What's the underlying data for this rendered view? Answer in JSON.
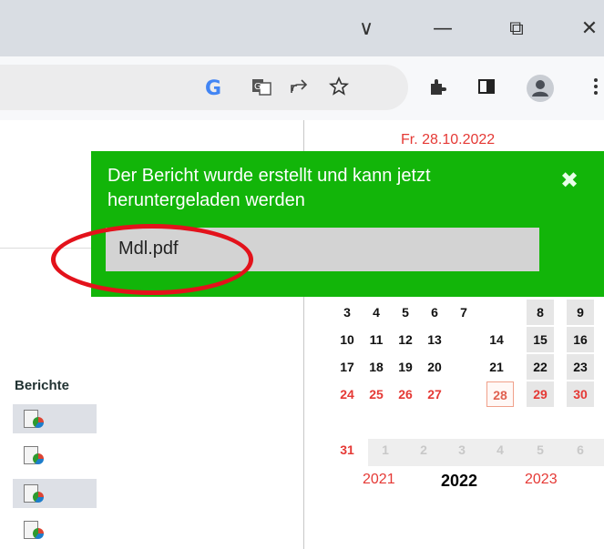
{
  "titlebar": {
    "controls": [
      "∨",
      "—",
      "⧉",
      "✕"
    ]
  },
  "toolbar": {
    "icons": [
      "google-icon",
      "translate-icon",
      "share-icon",
      "star-icon",
      "extensions-icon",
      "side-panel-icon",
      "profile-icon",
      "menu-icon"
    ],
    "g_label": "G"
  },
  "calendar": {
    "date_header": "Fr. 28.10.2022",
    "weeks": [
      [
        "3",
        "4",
        "5",
        "6",
        "7",
        "8",
        "9"
      ],
      [
        "10",
        "11",
        "12",
        "13",
        "14",
        "15",
        "16"
      ],
      [
        "17",
        "18",
        "19",
        "20",
        "21",
        "22",
        "23"
      ],
      [
        "24",
        "25",
        "26",
        "27",
        "28",
        "29",
        "30"
      ],
      [
        "31",
        "1",
        "2",
        "3",
        "4",
        "5",
        "6"
      ]
    ],
    "years": [
      "2021",
      "2022",
      "2023"
    ]
  },
  "sidebar": {
    "section_title": "Berichte",
    "report_icons": [
      "report-icon",
      "report-icon",
      "report-icon",
      "report-icon"
    ]
  },
  "notification": {
    "message": "Der Bericht wurde erstellt und kann jetzt heruntergeladen werden",
    "close": "✖",
    "file_name": "Mdl.pdf"
  },
  "colors": {
    "notification_bg": "#12b509",
    "highlight_red": "#e3121b",
    "weekend_red": "#e53935"
  }
}
